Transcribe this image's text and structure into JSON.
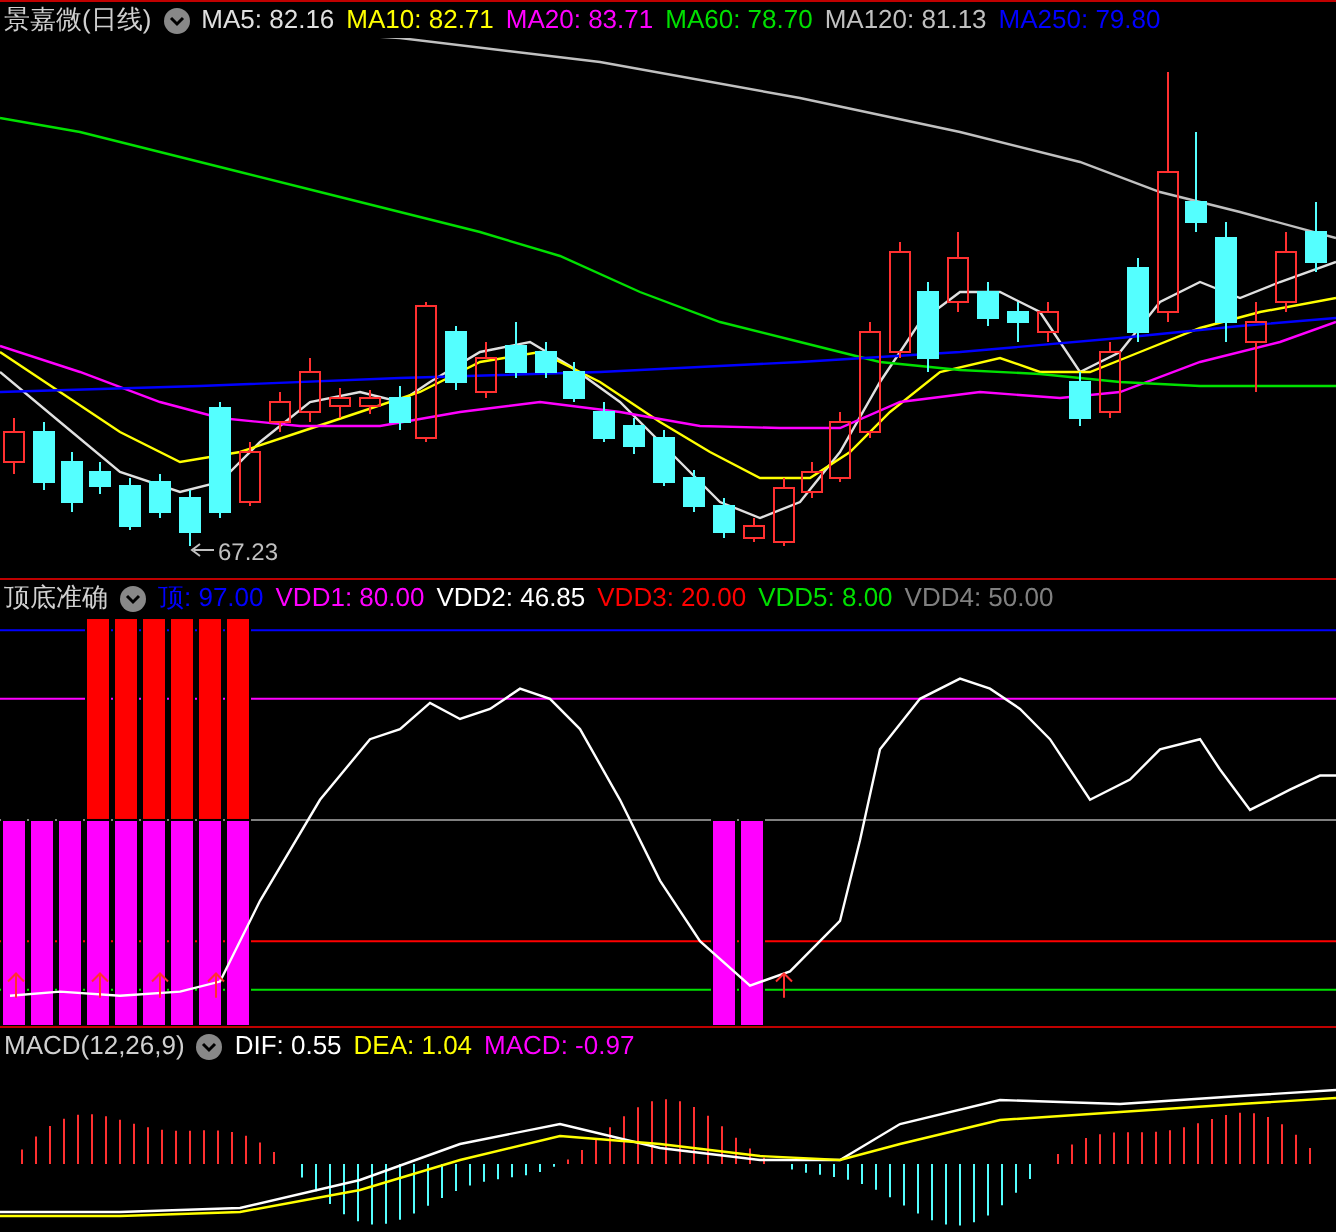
{
  "panels": [
    {
      "kind": "price",
      "title": "景嘉微(日线)",
      "legend": [
        {
          "label": "MA5: 82.16",
          "color": "#e0e0e0"
        },
        {
          "label": "MA10: 82.71",
          "color": "#ffff00"
        },
        {
          "label": "MA20: 83.71",
          "color": "#ff00ff"
        },
        {
          "label": "MA60: 78.70",
          "color": "#00e000"
        },
        {
          "label": "MA120: 81.13",
          "color": "#c0c0c0"
        },
        {
          "label": "MA250: 79.80",
          "color": "#0000ff"
        }
      ],
      "low_price_label": "67.23"
    },
    {
      "kind": "signal",
      "title": "顶底准确",
      "legend": [
        {
          "label": "顶: 97.00",
          "color": "#0000ff"
        },
        {
          "label": "VDD1: 80.00",
          "color": "#ff00ff"
        },
        {
          "label": "VDD2: 46.85",
          "color": "#ffffff"
        },
        {
          "label": "VDD3: 20.00",
          "color": "#ff0000"
        },
        {
          "label": "VDD5: 8.00",
          "color": "#00e000"
        },
        {
          "label": "VDD4: 50.00",
          "color": "#808080"
        }
      ]
    },
    {
      "kind": "macd",
      "title": "MACD(12,26,9)",
      "legend": [
        {
          "label": "DIF: 0.55",
          "color": "#ffffff"
        },
        {
          "label": "DEA: 1.04",
          "color": "#ffff00"
        },
        {
          "label": "MACD: -0.97",
          "color": "#ff00ff"
        }
      ]
    }
  ]
}
